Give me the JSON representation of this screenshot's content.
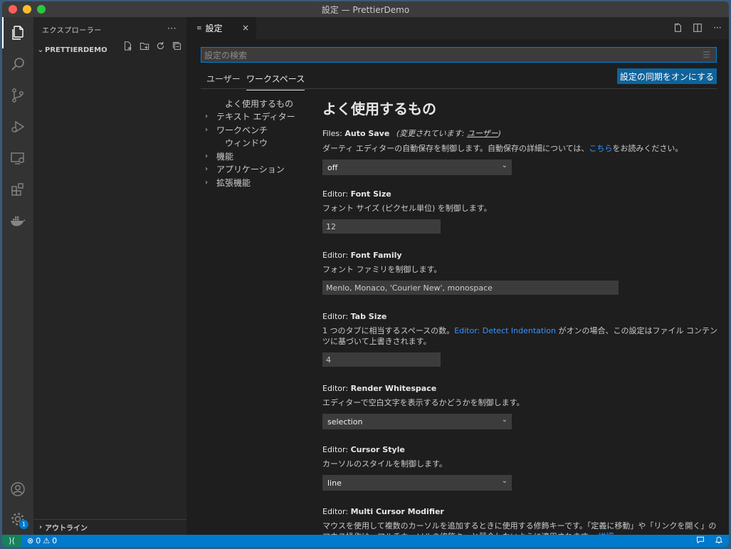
{
  "window": {
    "title": "設定 — PrettierDemo"
  },
  "activity_bar": {
    "items": [
      "files-icon",
      "search-icon",
      "source-control-icon",
      "run-debug-icon",
      "remote-explorer-icon",
      "extensions-icon",
      "docker-icon"
    ],
    "bottom": [
      "account-icon",
      "manage-gear-icon"
    ],
    "badge_count": "1"
  },
  "sidebar": {
    "header": "エクスプローラー",
    "more": "···",
    "folder_name": "PRETTIERDEMO",
    "outline": "アウトライン"
  },
  "editor": {
    "tab_label": "設定",
    "tab_icon": "≡",
    "tab_close": "×"
  },
  "settings": {
    "search_placeholder": "設定の検索",
    "scopes": [
      "ユーザー",
      "ワークスペース"
    ],
    "sync_button": "設定の同期をオンにする",
    "toc": [
      {
        "label": "よく使用するもの",
        "chevron": false
      },
      {
        "label": "テキスト エディター",
        "chevron": true
      },
      {
        "label": "ワークベンチ",
        "chevron": true
      },
      {
        "label": "ウィンドウ",
        "chevron": false
      },
      {
        "label": "機能",
        "chevron": true
      },
      {
        "label": "アプリケーション",
        "chevron": true
      },
      {
        "label": "拡張機能",
        "chevron": true
      }
    ],
    "section_title": "よく使用するもの",
    "items": {
      "auto_save": {
        "category": "Files: ",
        "name": "Auto Save",
        "modified_prefix": "(変更されています: ",
        "modified_scope": "ユーザー",
        "modified_suffix": ")",
        "desc_before": "ダーティ エディターの自動保存を制御します。自動保存の詳細については、",
        "desc_link": "こちら",
        "desc_after": "をお読みください。",
        "value": "off"
      },
      "font_size": {
        "category": "Editor: ",
        "name": "Font Size",
        "desc": "フォント サイズ (ピクセル単位) を制御します。",
        "value": "12"
      },
      "font_family": {
        "category": "Editor: ",
        "name": "Font Family",
        "desc": "フォント ファミリを制御します。",
        "value": "Menlo, Monaco, 'Courier New', monospace"
      },
      "tab_size": {
        "category": "Editor: ",
        "name": "Tab Size",
        "desc_before": "1 つのタブに相当するスペースの数。",
        "desc_link": "Editor: Detect Indentation",
        "desc_after": " がオンの場合、この設定はファイル コンテンツに基づいて上書きされます。",
        "value": "4"
      },
      "render_whitespace": {
        "category": "Editor: ",
        "name": "Render Whitespace",
        "desc": "エディターで空白文字を表示するかどうかを制御します。",
        "value": "selection"
      },
      "cursor_style": {
        "category": "Editor: ",
        "name": "Cursor Style",
        "desc": "カーソルのスタイルを制御します。",
        "value": "line"
      },
      "multi_cursor": {
        "category": "Editor: ",
        "name": "Multi Cursor Modifier",
        "desc": "マウスを使用して複数のカーソルを追加するときに使用する修飾キーです。「定義に移動」や「リンクを開く」のマウス操作は、マルチカーソルの修飾キーと競合しないように適用されます。",
        "desc_link": "詳細"
      }
    }
  },
  "status_bar": {
    "errors": "0",
    "warnings": "0"
  }
}
